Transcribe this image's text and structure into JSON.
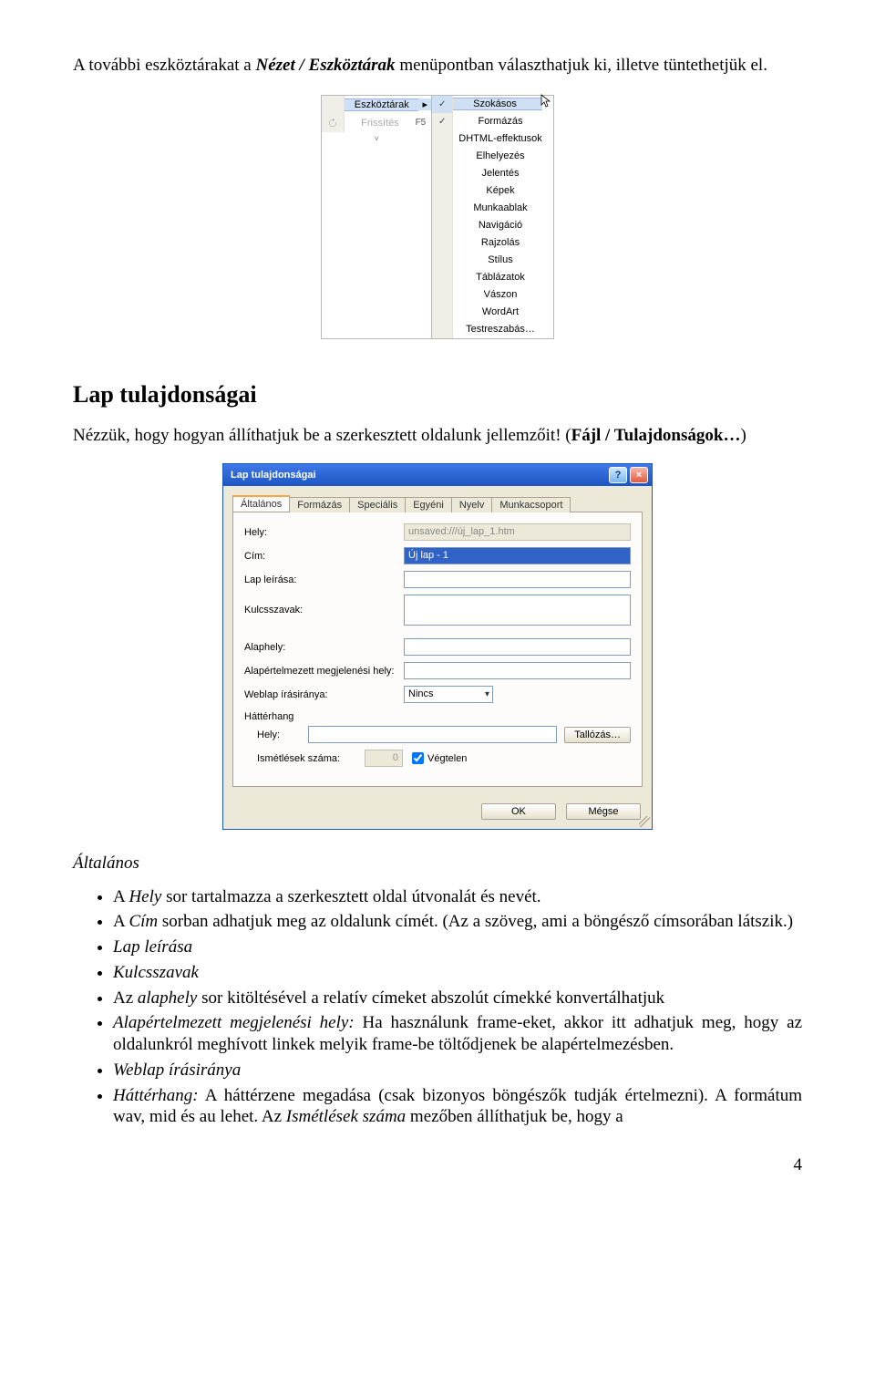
{
  "intro_pre": "A további eszköztárakat a ",
  "intro_em1": "Nézet / Eszköztárak",
  "intro_mid": " menüpontban választhatjuk ki, illetve tüntethetjük el.",
  "menu": {
    "left": {
      "toolbars": "Eszköztárak",
      "refresh": "Frissítés",
      "refresh_key": "F5",
      "chevrons": "˅"
    },
    "right": [
      {
        "label": "Szokásos",
        "checked": true,
        "hl": true
      },
      {
        "label": "Formázás",
        "checked": true
      },
      {
        "label": "DHTML-effektusok"
      },
      {
        "label": "Elhelyezés"
      },
      {
        "label": "Jelentés"
      },
      {
        "label": "Képek"
      },
      {
        "label": "Munkaablak"
      },
      {
        "label": "Navigáció"
      },
      {
        "label": "Rajzolás"
      },
      {
        "label": "Stílus"
      },
      {
        "label": "Táblázatok"
      },
      {
        "label": "Vászon"
      },
      {
        "label": "WordArt"
      },
      {
        "label": "Testreszabás…"
      }
    ]
  },
  "heading": "Lap tulajdonságai",
  "para2_a": "Nézzük, hogy hogyan állíthatjuk be a szerkesztett oldalunk jellemzőit! (",
  "para2_b": "Fájl / Tulajdonságok…",
  "para2_c": ")",
  "dialog": {
    "title": "Lap tulajdonságai",
    "help": "?",
    "close": "×",
    "tabs": [
      "Általános",
      "Formázás",
      "Speciális",
      "Egyéni",
      "Nyelv",
      "Munkacsoport"
    ],
    "labels": {
      "hely": "Hely:",
      "cim": "Cím:",
      "lap_leirasa": "Lap leírása:",
      "kulcsszavak": "Kulcsszavak:",
      "alaphely": "Alaphely:",
      "def_target": "Alapértelmezett megjelenési hely:",
      "webdir": "Weblap írásiránya:",
      "hatterhang": "Háttérhang",
      "hely2": "Hely:",
      "ismetlesek": "Ismétlések száma:"
    },
    "values": {
      "hely": "unsaved:///új_lap_1.htm",
      "cim": "Új lap - 1",
      "webdir": "Nincs",
      "num": "0",
      "vegtelen": "Végtelen",
      "tallozas": "Tallózás…"
    },
    "buttons": {
      "ok": "OK",
      "cancel": "Mégse"
    }
  },
  "subheading": "Általános",
  "bullets": {
    "b1a": "A ",
    "b1b": "Hely",
    "b1c": " sor tartalmazza a szerkesztett oldal útvonalát és nevét.",
    "b2a": "A ",
    "b2b": "Cím",
    "b2c": " sorban adhatjuk meg az oldalunk címét. (Az a szöveg, ami a böngésző címsorában látszik.)",
    "b3": "Lap leírása",
    "b4": "Kulcsszavak",
    "b5a": "Az ",
    "b5b": "alaphely",
    "b5c": " sor kitöltésével a relatív címeket abszolút címekké konvertálhatjuk",
    "b6a": "Alapértelmezett megjelenési hely:",
    "b6b": " Ha használunk frame-eket, akkor itt adhatjuk meg, hogy az oldalunkról meghívott linkek melyik frame-be töltődjenek be alapértelmezésben.",
    "b7": "Weblap írásiránya",
    "b8a": "Háttérhang:",
    "b8b": " A háttérzene megadása (csak bizonyos böngészők tudják értelmezni). A formátum wav, mid és au lehet. Az ",
    "b8c": "Ismétlések száma",
    "b8d": " mezőben állíthatjuk be, hogy a"
  },
  "page_number": "4"
}
